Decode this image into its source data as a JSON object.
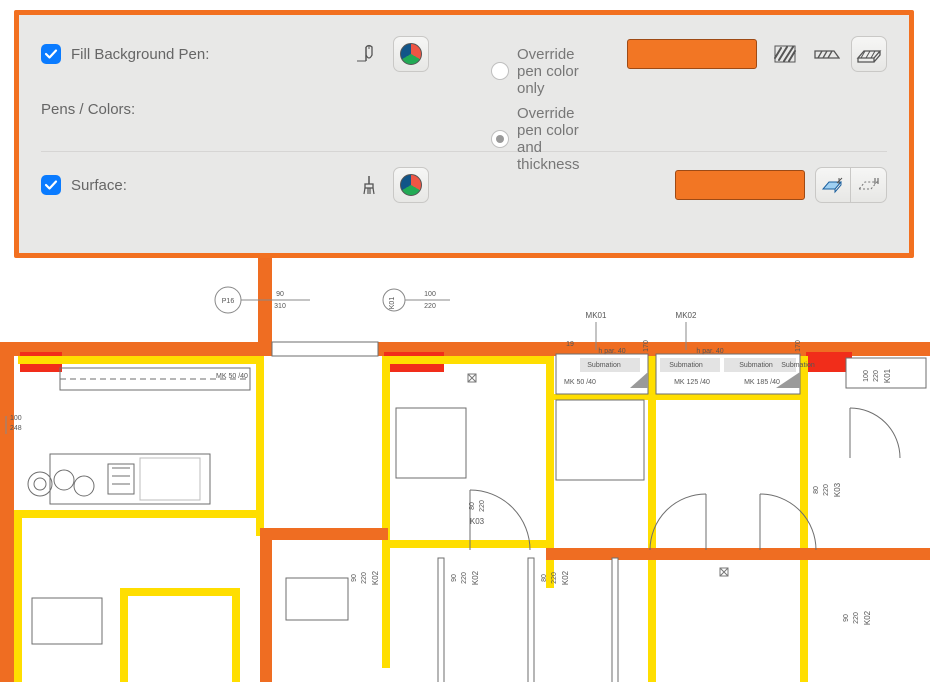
{
  "panel": {
    "fill_background_pen_label": "Fill Background Pen:",
    "pens_colors_label": "Pens / Colors:",
    "surface_label": "Surface:",
    "radio_color_only": "Override pen color only",
    "radio_color_thick": "Override pen color and thickness",
    "swatch_color": "#f27624",
    "fill_checked": true,
    "surface_checked": true,
    "pen_override_mode": "color_and_thickness"
  },
  "plan": {
    "labels": {
      "p16": "P16",
      "dim_90_310": [
        "90",
        "310"
      ],
      "dim_100_248": [
        "100",
        "248"
      ],
      "dim_100_220": [
        "100",
        "220"
      ],
      "k01": "K01",
      "k02": "K02",
      "k03": "K03",
      "mk01": "MK01",
      "mk02": "MK02",
      "mk50_40": "MK 50 /40",
      "mk50_40b": "MK 50 /40",
      "mk125_40": "MK 125 /40",
      "mk185_40": "MK 185 /40",
      "hpar_40a": "h par. 40",
      "hpar_40b": "h par. 40",
      "submation": "Submation",
      "val_19": "19",
      "val_170a": "170",
      "val_170b": "170",
      "dim_80_220": [
        "80",
        "220"
      ],
      "dim_90_220": [
        "90",
        "220"
      ],
      "dim_100_220b": [
        "100",
        "220"
      ]
    },
    "colors": {
      "wall_orange": "#ef6d22",
      "wall_yellow": "#ffde00",
      "wall_red": "#f12d1a",
      "line_gray": "#6e6e6e",
      "line_light": "#bdbdbd"
    }
  }
}
